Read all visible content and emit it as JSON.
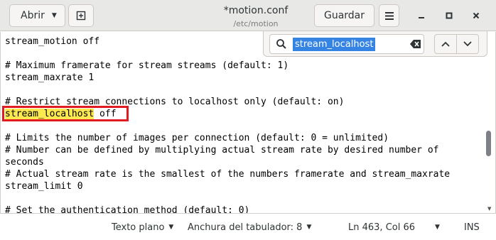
{
  "header": {
    "open_label": "Abrir",
    "title": "*motion.conf",
    "subtitle": "/etc/motion",
    "save_label": "Guardar"
  },
  "editor": {
    "lines": [
      "stream_motion off",
      "",
      "# Maximum framerate for stream streams (default: 1)",
      "stream_maxrate 1",
      "",
      "# Restrict stream connections to localhost only (default: on)",
      "",
      "",
      "# Limits the number of images per connection (default: 0 = unlimited)",
      "# Number can be defined by multiplying actual stream rate by desired number of",
      "seconds",
      "# Actual stream rate is the smallest of the numbers framerate and stream_maxrate",
      "stream_limit 0",
      "",
      "# Set the authentication method (default: 0)"
    ],
    "highlight_word": "stream_localhost",
    "highlight_rest": " off",
    "highlight_color": "#fce94f",
    "box_color": "#e01b24"
  },
  "search": {
    "query": "stream_localhost",
    "selection_color": "#3584e4"
  },
  "statusbar": {
    "language": "Texto plano",
    "tab_width": "Anchura del tabulador: 8",
    "position": "Ln 463, Col 66",
    "mode": "INS"
  }
}
